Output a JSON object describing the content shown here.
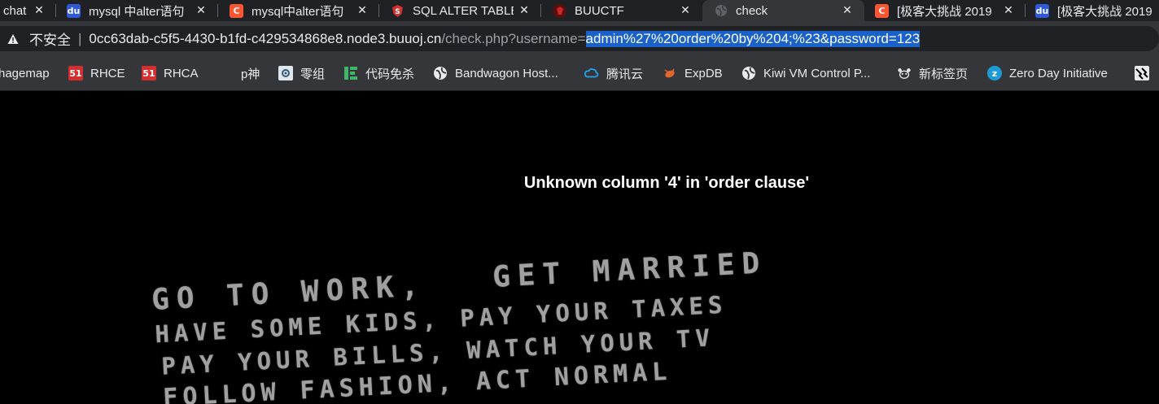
{
  "tabs": [
    {
      "title": "chat",
      "favicon": "baidu-paw",
      "color": "#2e59d9",
      "active": false
    },
    {
      "title": "mysql 中alter语句",
      "favicon": "baidu-paw",
      "color": "#2e59d9",
      "active": false
    },
    {
      "title": "mysql中alter语句",
      "favicon": "csdn-c",
      "color": "#fc5531",
      "active": false
    },
    {
      "title": "SQL ALTER TABLE",
      "favicon": "shield",
      "color": "#d32f2f",
      "active": false
    },
    {
      "title": "BUUCTF",
      "favicon": "buuctf-logo",
      "color": "#8b1a1a",
      "active": false
    },
    {
      "title": "check",
      "favicon": "globe",
      "color": "#9aa0a6",
      "active": true
    },
    {
      "title": "[极客大挑战 2019",
      "favicon": "csdn-c",
      "color": "#fc5531",
      "active": false
    },
    {
      "title": "[极客大挑战 2019",
      "favicon": "baidu-paw",
      "color": "#2e59d9",
      "active": false
    }
  ],
  "address_bar": {
    "security_label": "不安全",
    "host": "0cc63dab-c5f5-4430-b1fd-c429534868e8.node3.buuoj.cn",
    "path": "/check.php?username=",
    "selected": "admin%27%20order%20by%204;%23&password=123"
  },
  "bookmarks": [
    {
      "label": "hagemap",
      "icon": "none"
    },
    {
      "label": "RHCE",
      "icon": "51-badge"
    },
    {
      "label": "RHCA",
      "icon": "51-badge"
    },
    {
      "label": "p神",
      "icon": "none"
    },
    {
      "label": "零组",
      "icon": "gear-grid"
    },
    {
      "label": "代码免杀",
      "icon": "green-bars"
    },
    {
      "label": "Bandwagon Host...",
      "icon": "globe"
    },
    {
      "label": "腾讯云",
      "icon": "cloud"
    },
    {
      "label": "ExpDB",
      "icon": "bug"
    },
    {
      "label": "Kiwi VM Control P...",
      "icon": "globe"
    },
    {
      "label": "新标签页",
      "icon": "panda"
    },
    {
      "label": "Zero Day Initiative",
      "icon": "z-circle"
    },
    {
      "label": "",
      "icon": "monkey"
    }
  ],
  "page": {
    "error_message": "Unknown column '4' in 'order clause'",
    "shirt_lines": [
      "GET MARRIED",
      "GO TO WORK,",
      "HAVE SOME KIDS, PAY YOUR TAXES",
      "PAY YOUR BILLS, WATCH YOUR TV",
      "FOLLOW FASHION, ACT NORMAL"
    ]
  }
}
